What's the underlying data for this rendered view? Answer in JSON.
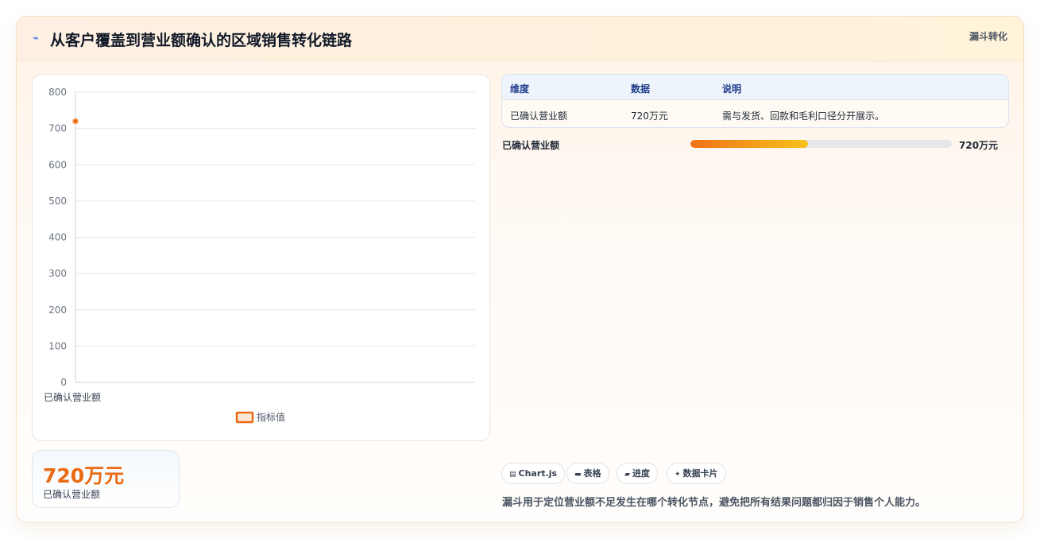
{
  "header": {
    "icon": "lightning-icon",
    "title": "从客户覆盖到营业额确认的区域销售转化链路",
    "tag": "漏斗转化"
  },
  "chart_data": {
    "type": "line",
    "categories": [
      "已确认营业额"
    ],
    "series": [
      {
        "name": "指标值",
        "values": [
          720
        ],
        "color": "#ea6a12"
      }
    ],
    "ylim": [
      0,
      800
    ],
    "yticks": [
      0,
      100,
      200,
      300,
      400,
      500,
      600,
      700,
      800
    ],
    "grid": true,
    "legend": "bottom-center"
  },
  "kpi": {
    "value": "720万元",
    "label": "已确认营业额"
  },
  "table": {
    "headers": [
      "维度",
      "数据",
      "说明"
    ],
    "rows": [
      [
        "已确认营业额",
        "720万元",
        "需与发货、回款和毛利口径分开展示。"
      ]
    ]
  },
  "progress": {
    "label": "已确认营业额",
    "value_text": "720万元",
    "fraction": 0.45
  },
  "chips": [
    {
      "icon": "chart-icon",
      "label": "Chart.js"
    },
    {
      "icon": "table-icon",
      "label": "表格"
    },
    {
      "icon": "progress-icon",
      "label": "进度"
    },
    {
      "icon": "sparkle-icon",
      "label": "数据卡片"
    }
  ],
  "note": "漏斗用于定位营业额不足发生在哪个转化节点，避免把所有结果问题都归因于销售个人能力。",
  "colors": {
    "accent": "#ea6a12",
    "header_title": "#111827",
    "table_header": "#1e3a8a"
  }
}
